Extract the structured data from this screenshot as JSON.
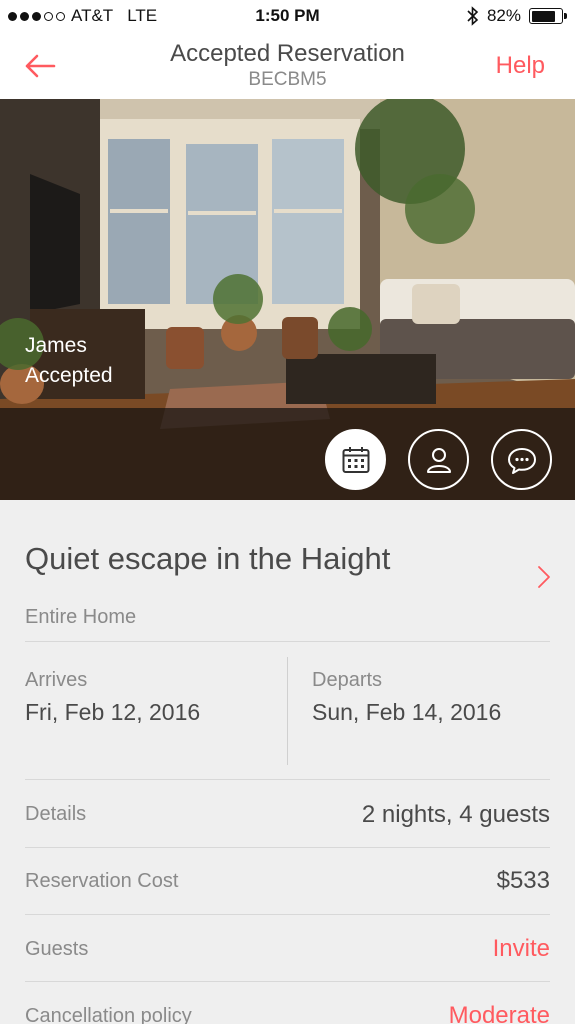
{
  "status_bar": {
    "carrier": "AT&T",
    "network": "LTE",
    "time": "1:50 PM",
    "battery_percent": "82%",
    "battery_level": 0.82,
    "signal_bars_filled": 3,
    "signal_bars_total": 5
  },
  "header": {
    "back_icon": "arrow-left-icon",
    "title": "Accepted Reservation",
    "confirmation_code": "BECBM5",
    "help_label": "Help"
  },
  "hero": {
    "guest_name": "James",
    "status": "Accepted",
    "actions": [
      {
        "name": "calendar",
        "icon": "calendar-icon",
        "active": true
      },
      {
        "name": "profile",
        "icon": "person-icon",
        "active": false
      },
      {
        "name": "message",
        "icon": "chat-bubble-icon",
        "active": false
      }
    ]
  },
  "listing": {
    "title": "Quiet escape in the Haight",
    "type": "Entire Home"
  },
  "dates": {
    "arrives_label": "Arrives",
    "arrives_value": "Fri, Feb 12, 2016",
    "departs_label": "Departs",
    "departs_value": "Sun, Feb 14, 2016"
  },
  "rows": [
    {
      "label": "Details",
      "value": "2 nights, 4 guests",
      "accent": false
    },
    {
      "label": "Reservation Cost",
      "value": "$533",
      "accent": false
    },
    {
      "label": "Guests",
      "value": "Invite",
      "accent": true
    },
    {
      "label": "Cancellation policy",
      "value": "Moderate",
      "accent": true
    }
  ],
  "colors": {
    "accent": "#ff5a5f",
    "text": "#4a4a4a",
    "muted": "#8a8a8a",
    "background": "#efefef"
  }
}
